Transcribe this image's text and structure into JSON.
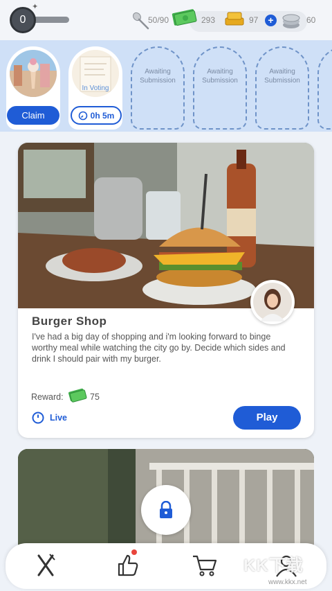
{
  "header": {
    "level": "0",
    "spoons": "50/90",
    "cash": "293",
    "gold": "97",
    "plus_label": "+",
    "coins": "60",
    "icons": [
      "sparkle-icon",
      "spoon-icon",
      "cash-icon",
      "gold-bars-icon",
      "plus-icon",
      "coins-icon"
    ]
  },
  "submissions": {
    "slots": [
      {
        "state": "claim",
        "button": "Claim"
      },
      {
        "state": "in-voting",
        "status": "In Voting",
        "timer": "0h 5m"
      },
      {
        "state": "empty",
        "text_line1": "Awaiting",
        "text_line2": "Submission"
      },
      {
        "state": "empty",
        "text_line1": "Awaiting",
        "text_line2": "Submission"
      },
      {
        "state": "empty",
        "text_line1": "Awaiting",
        "text_line2": "Submission"
      }
    ]
  },
  "challenge": {
    "title": "Burger Shop",
    "description": "I've had a big day of shopping and i'm looking forward to binge worthy meal while watching the city go by. Decide which sides and drink I should pair with my burger.",
    "reward_label": "Reward:",
    "reward_value": "75",
    "status": "Live",
    "play_label": "Play"
  },
  "bottom_nav": {
    "items": [
      "fork-knife-icon",
      "thumbs-up-icon",
      "cart-icon",
      "profile-icon"
    ],
    "notification_on": "thumbs-up-icon"
  },
  "watermark": {
    "text": "KK下载",
    "sub": "www.kkx.net"
  },
  "colors": {
    "accent": "#1f5cd6",
    "strip_bg": "#cfe0f7",
    "page_bg": "#eef2f8",
    "notification": "#e8453c"
  }
}
